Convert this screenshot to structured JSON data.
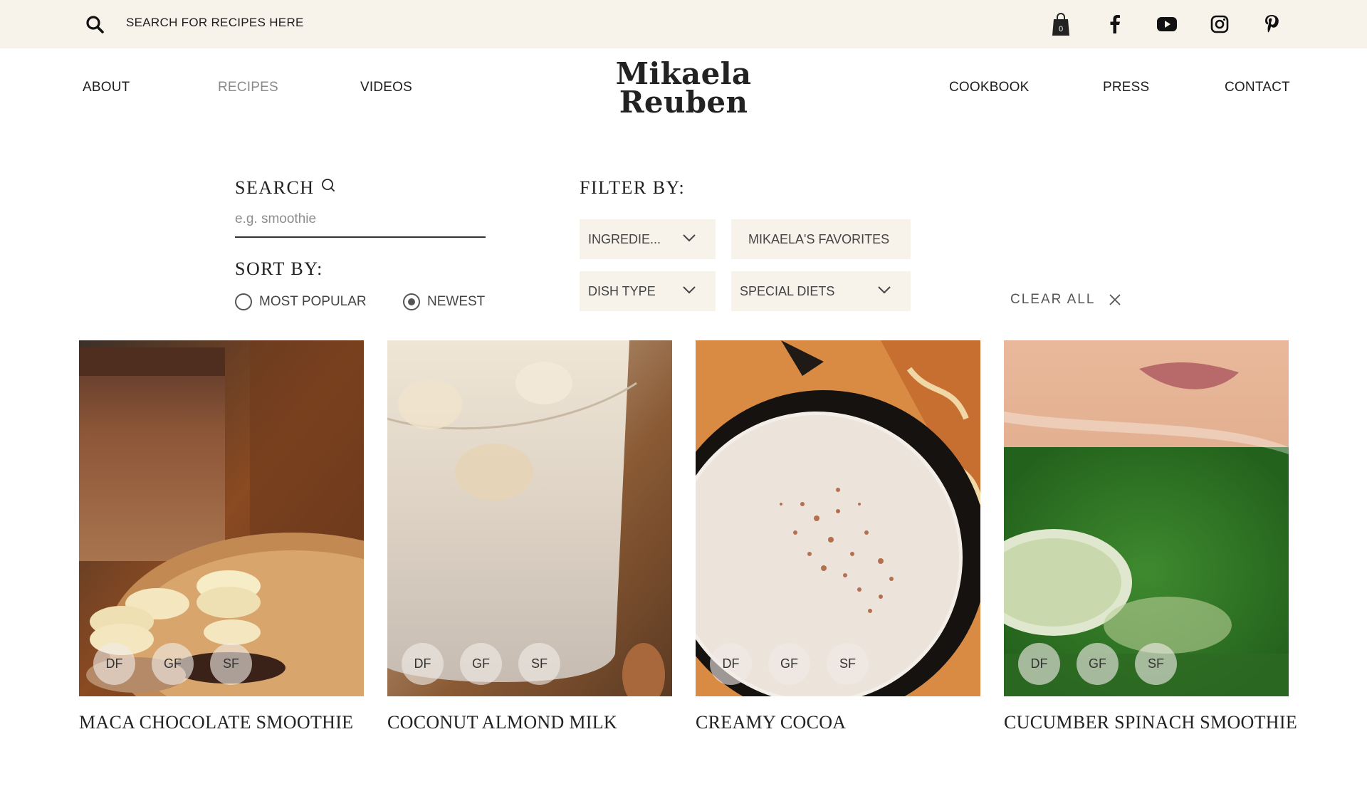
{
  "topbar": {
    "search_placeholder": "SEARCH FOR RECIPES HERE",
    "cart_count": "0",
    "icons": [
      "search-icon",
      "shopping-bag-icon",
      "facebook-icon",
      "youtube-icon",
      "instagram-icon",
      "pinterest-icon"
    ]
  },
  "nav": {
    "left": [
      "ABOUT",
      "RECIPES",
      "VIDEOS"
    ],
    "right": [
      "COOKBOOK",
      "PRESS",
      "CONTACT"
    ],
    "active": "RECIPES"
  },
  "logo": {
    "line1": "Mikaela",
    "line2": "Reuben"
  },
  "search": {
    "label": "SEARCH",
    "placeholder": "e.g. smoothie",
    "value": ""
  },
  "sort": {
    "label": "SORT BY:",
    "options": [
      {
        "label": "MOST POPULAR",
        "checked": false
      },
      {
        "label": "NEWEST",
        "checked": true
      }
    ]
  },
  "filter": {
    "label": "FILTER BY:",
    "ingredients": "INGREDIE...",
    "favorites": "MIKAELA'S FAVORITES",
    "dish_type": "DISH TYPE",
    "special_diets": "SPECIAL DIETS",
    "clear_all": "CLEAR ALL"
  },
  "recipes": [
    {
      "title": "MACA CHOCOLATE SMOOTHIE",
      "badges": [
        "DF",
        "GF",
        "SF"
      ]
    },
    {
      "title": "COCONUT ALMOND MILK",
      "badges": [
        "DF",
        "GF",
        "SF"
      ]
    },
    {
      "title": "CREAMY COCOA",
      "badges": [
        "DF",
        "GF",
        "SF"
      ]
    },
    {
      "title": "CUCUMBER SPINACH SMOOTHIE",
      "badges": [
        "DF",
        "GF",
        "SF"
      ]
    }
  ],
  "colors": {
    "topbar_bg": "#f8f3ea",
    "filter_bg": "#f8f3ea",
    "text": "#1e1e1e",
    "active_nav": "#8a8a8a"
  }
}
